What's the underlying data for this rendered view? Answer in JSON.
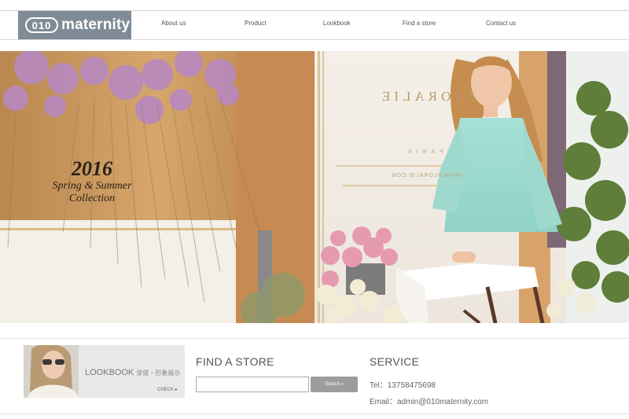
{
  "header": {
    "logo_mark": "010",
    "logo_word": "maternity",
    "nav": [
      {
        "label": "About us"
      },
      {
        "label": "Product"
      },
      {
        "label": "Lookbook"
      },
      {
        "label": "Find a store"
      },
      {
        "label": "Contact us"
      }
    ]
  },
  "hero": {
    "year": "2016",
    "season": "Spring & Summer",
    "collection": "Collection",
    "brand_sign": "FLORALIE",
    "paris_sign": "PARIS",
    "web_sign": "WWW.FLORALIE.COM"
  },
  "lookbook": {
    "label": "LOOKBOOK",
    "sub": "穿搭・形象展示",
    "check": "CHECK"
  },
  "find_store": {
    "title": "FIND A STORE",
    "input_value": "",
    "button_label": "Search"
  },
  "service": {
    "title": "SERVICE",
    "tel": "Tel：13758475698",
    "email": "Email：admin@010maternity.com"
  },
  "colors": {
    "logo_bg": "#7f8c97",
    "button_bg": "#9d9d9d",
    "heading_text": "#555555"
  }
}
